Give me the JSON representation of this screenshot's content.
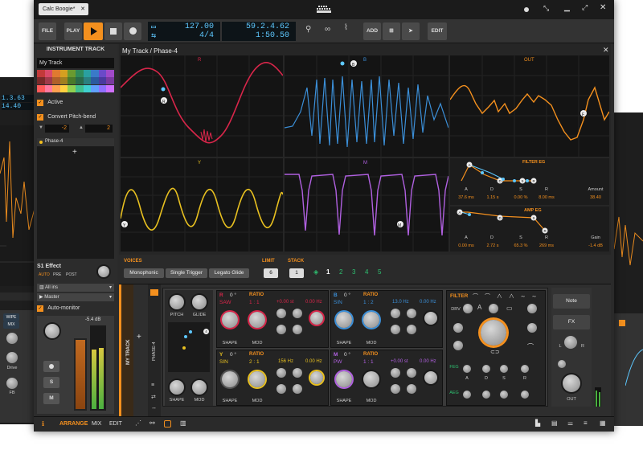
{
  "window": {
    "tab_title": "Calc Boogie*"
  },
  "toolbar": {
    "file": "FILE",
    "play": "PLAY",
    "tempo": "127.00",
    "time_sig": "4/4",
    "position": "59.2.4.62",
    "time": "1:50.50",
    "add": "ADD",
    "edit": "EDIT"
  },
  "inspector": {
    "title": "INSTRUMENT TRACK",
    "track_name": "My Track",
    "active": "Active",
    "convert_pitch_bend": "Convert Pitch-bend",
    "pb_down": "-2",
    "pb_up": "2",
    "device": "Phase-4",
    "s1_effect": "S1 Effect",
    "auto": "AUTO",
    "pre": "PRE",
    "post": "POST",
    "input": "All ins",
    "output": "Master",
    "auto_monitor": "Auto-monitor",
    "level": "-5.4 dB",
    "s_label": "S",
    "m_label": "M",
    "colors": [
      "#c23a3a",
      "#d94a6a",
      "#e07a30",
      "#d4a020",
      "#6a9a30",
      "#2f8a5a",
      "#2aa0a0",
      "#3a7ac8",
      "#6a4ac8",
      "#a04ac8",
      "#7a2a2a",
      "#a03a4a",
      "#b0602a",
      "#a08020",
      "#4a7a2a",
      "#2a6a4a",
      "#2a8080",
      "#2a5aa0",
      "#4a3aa0",
      "#7a3aa0",
      "#ff5a5a",
      "#ff7aa0",
      "#ffa050",
      "#ffd040",
      "#90d050",
      "#40c090",
      "#40d0d0",
      "#60a0ff",
      "#9070ff",
      "#d070ff"
    ]
  },
  "editor": {
    "title": "My Track / Phase-4",
    "osc_labels": [
      "R",
      "B",
      "OUT",
      "Y",
      "M"
    ],
    "filter_eg": {
      "title": "FILTER EG",
      "labels": [
        "A",
        "D",
        "S",
        "R",
        "Amount"
      ],
      "values": [
        "37.6 ms",
        "1.15 s",
        "0.00 %",
        "8.00 ms",
        "38.40"
      ]
    },
    "amp_eg": {
      "title": "AMP EG",
      "labels": [
        "A",
        "D",
        "S",
        "R",
        "Gain"
      ],
      "values": [
        "0.00 ms",
        "2.72 s",
        "65.3 %",
        "269 ms",
        "-1.4 dB"
      ]
    },
    "voices_label": "VOICES",
    "voice_modes": [
      "Monophonic",
      "Single Trigger",
      "Legato Glide"
    ],
    "limit_label": "LIMIT",
    "limit_value": "6",
    "stack_label": "STACK",
    "stack_value": "1",
    "stack_options": [
      "1",
      "2",
      "3",
      "4",
      "5"
    ]
  },
  "devices": {
    "track_label": "MY TRACK",
    "device_label": "PHASE-4",
    "pitch": "PITCH",
    "glide": "GLIDE",
    "shape": "SHAPE",
    "mod": "MOD",
    "pad_number": "4",
    "osc": [
      {
        "id": "R",
        "deg": "0 °",
        "ratio_label": "RATIO",
        "wave": "SAW",
        "ratio": "1 : 1",
        "st": "+0.00 st",
        "hz": "0.00 Hz"
      },
      {
        "id": "B",
        "deg": "0 °",
        "ratio_label": "RATIO",
        "wave": "SIN",
        "ratio": "1 : 2",
        "st": "13.0 Hz",
        "hz": "0.00 Hz"
      },
      {
        "id": "Y",
        "deg": "0 °",
        "ratio_label": "RATIO",
        "wave": "SIN",
        "ratio": "2 : 1",
        "st": "156 Hz",
        "hz": "0.00 Hz"
      },
      {
        "id": "M",
        "deg": "0 °",
        "ratio_label": "RATIO",
        "wave": "PW",
        "ratio": "1 : 1",
        "st": "+0.00 st",
        "hz": "0.00 Hz"
      }
    ],
    "filter": "FILTER",
    "drv": "DRV",
    "feg": "FEG",
    "aeg": "AEG",
    "adsr": [
      "A",
      "D",
      "S",
      "R"
    ],
    "note": "Note",
    "fx": "FX",
    "out": "OUT",
    "l": "L",
    "r": "R"
  },
  "statusbar": {
    "arrange": "ARRANGE",
    "mix": "MIX",
    "edit": "EDIT"
  },
  "background_left": {
    "pos1": "1.3.63",
    "pos2": "14.40",
    "drive": "Drive",
    "fb": "FB",
    "wipe": "WIPE",
    "mix": "MIX"
  }
}
